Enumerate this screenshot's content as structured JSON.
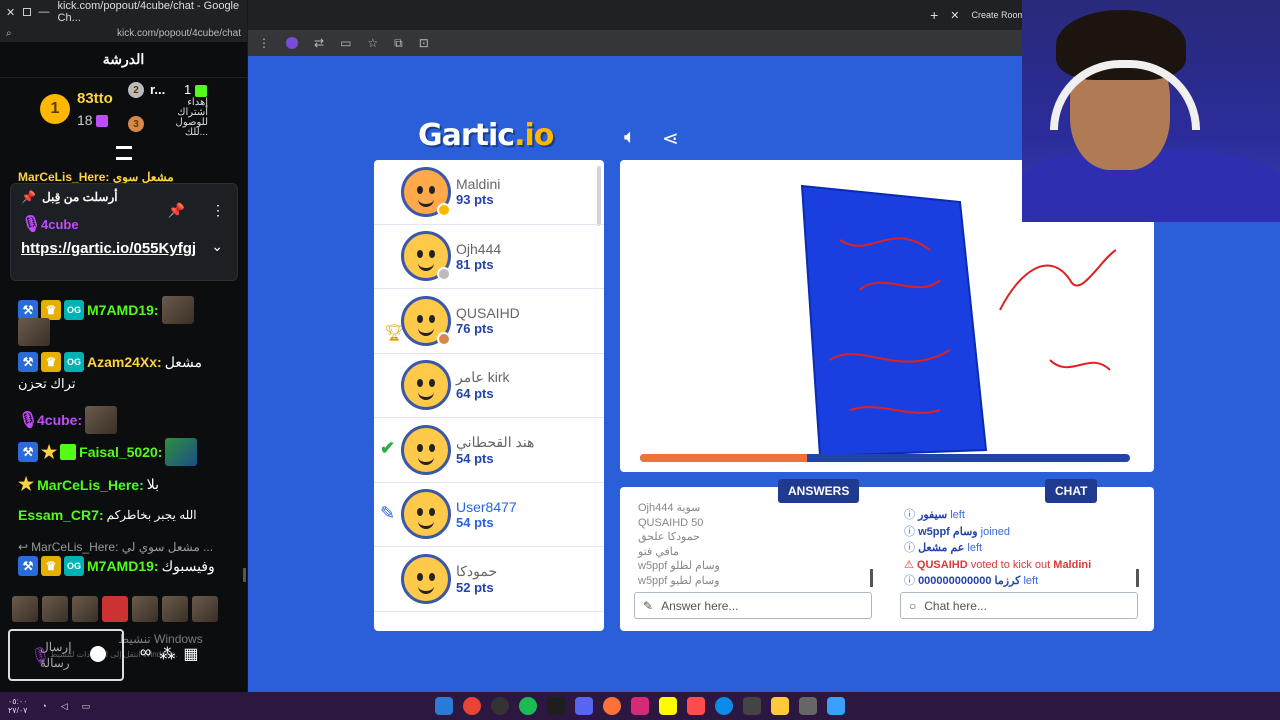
{
  "kick": {
    "window_url_title": "kick.com/popout/4cube/chat - Google Ch...",
    "address": "kick.com/popout/4cube/chat",
    "header": "الدرشة",
    "leaderboard": {
      "first_name": "83tto",
      "first_count": "18",
      "second_name": "r...",
      "second_count": "1",
      "third_text": "إهداء\nأشتراك\nللوصول\nللك..."
    },
    "top_line": "MarCeLis_Here: مشعل سوي",
    "pinned": {
      "label": "أرسلت من قِبل",
      "user": "4cube",
      "link": "https://gartic.io/055Kyfgj"
    },
    "messages": [
      {
        "user": "M7AMD19:",
        "text": ""
      },
      {
        "user": "Azam24Xx:",
        "text": "مشعل"
      },
      {
        "user": "",
        "text": "تراك تحزن"
      },
      {
        "user": "4cube:",
        "text": ""
      },
      {
        "user": "Faisal_5020:",
        "text": ""
      },
      {
        "user": "MarCeLis_Here:",
        "text": "بلا"
      },
      {
        "user": "Essam_CR7:",
        "text": "الله يجبر بخاطركم"
      },
      {
        "user": "",
        "text": "MarCeLis_Here: مشعل سوي لي ..."
      },
      {
        "user": "M7AMD19:",
        "text": "وفيسبوك"
      }
    ],
    "send_placeholder": "إرسال رسالة",
    "windows_watermark": "تنشيط Windows",
    "windows_watermark2": "انتقل إلى الإعدادات لتنشيط Windows."
  },
  "browser": {
    "new_tab_label": "Create Room"
  },
  "game": {
    "logo_main": "Gartic",
    "logo_suffix": ".io",
    "players": [
      {
        "name": "Maldini",
        "pts": "93 pts",
        "self": false
      },
      {
        "name": "Ojh444",
        "pts": "81 pts",
        "self": false
      },
      {
        "name": "QUSAIHD",
        "pts": "76 pts",
        "self": false
      },
      {
        "name": "عامر kirk",
        "pts": "64 pts",
        "self": false
      },
      {
        "name": "هند القحطاني",
        "pts": "54 pts",
        "self": false
      },
      {
        "name": "User8477",
        "pts": "54 pts",
        "self": true
      },
      {
        "name": "حمودكا",
        "pts": "52 pts",
        "self": false
      }
    ],
    "progress": 0.34,
    "answers_tab": "ANSWERS",
    "chat_tab": "CHAT",
    "answers_log": [
      "Ojh444 سوية",
      "QUSAIHD 50",
      "حمودكا علحق",
      "مافي فتو",
      "w5ppf وسام لظلو",
      "w5ppf وسام لطيو"
    ],
    "chat_log": [
      {
        "name": "سيفور",
        "action": "left",
        "red": false
      },
      {
        "name": "w5ppf وسام",
        "action": "joined",
        "red": false
      },
      {
        "name": "عم مشعل",
        "action": "left",
        "red": false
      },
      {
        "name": "QUSAIHD",
        "action": "voted to kick out",
        "target": "Maldini",
        "red": true
      },
      {
        "name": "000000000000 كرزما",
        "action": "left",
        "red": false
      }
    ],
    "answer_placeholder": "Answer here...",
    "chat_placeholder": "Chat here..."
  },
  "colors": {
    "game_bg": "#2a5fd9",
    "accent": "#1f3a8f",
    "kick_green": "#53fc18"
  }
}
